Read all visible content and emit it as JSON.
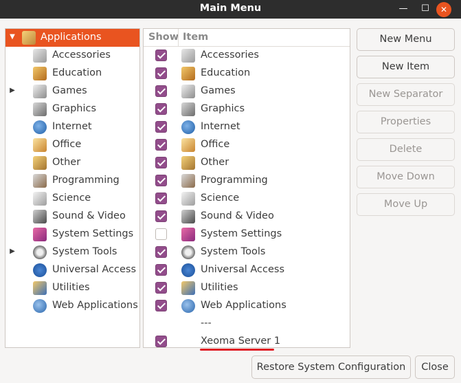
{
  "window": {
    "title": "Main Menu",
    "controls": {
      "minimize": "—",
      "maximize": "☐",
      "close": "✕"
    }
  },
  "tree": {
    "root": {
      "label": "Applications",
      "icon": "applications-icon",
      "expander": "▼"
    },
    "items": [
      {
        "label": "Accessories",
        "icon": "accessories-icon",
        "expander": ""
      },
      {
        "label": "Education",
        "icon": "education-icon",
        "expander": ""
      },
      {
        "label": "Games",
        "icon": "games-icon",
        "expander": "▶"
      },
      {
        "label": "Graphics",
        "icon": "graphics-icon",
        "expander": ""
      },
      {
        "label": "Internet",
        "icon": "internet-icon",
        "expander": ""
      },
      {
        "label": "Office",
        "icon": "office-icon",
        "expander": ""
      },
      {
        "label": "Other",
        "icon": "other-icon",
        "expander": ""
      },
      {
        "label": "Programming",
        "icon": "programming-icon",
        "expander": ""
      },
      {
        "label": "Science",
        "icon": "science-icon",
        "expander": ""
      },
      {
        "label": "Sound & Video",
        "icon": "sound-video-icon",
        "expander": ""
      },
      {
        "label": "System Settings",
        "icon": "system-settings-icon",
        "expander": ""
      },
      {
        "label": "System Tools",
        "icon": "system-tools-icon",
        "expander": "▶"
      },
      {
        "label": "Universal Access",
        "icon": "universal-access-icon",
        "expander": ""
      },
      {
        "label": "Utilities",
        "icon": "utilities-icon",
        "expander": ""
      },
      {
        "label": "Web Applications",
        "icon": "web-applications-icon",
        "expander": ""
      }
    ]
  },
  "list": {
    "headers": {
      "show": "Show",
      "item": "Item"
    },
    "rows": [
      {
        "label": "Accessories",
        "checked": true,
        "icon": "accessories-icon"
      },
      {
        "label": "Education",
        "checked": true,
        "icon": "education-icon"
      },
      {
        "label": "Games",
        "checked": true,
        "icon": "games-icon"
      },
      {
        "label": "Graphics",
        "checked": true,
        "icon": "graphics-icon"
      },
      {
        "label": "Internet",
        "checked": true,
        "icon": "internet-icon"
      },
      {
        "label": "Office",
        "checked": true,
        "icon": "office-icon"
      },
      {
        "label": "Other",
        "checked": true,
        "icon": "other-icon"
      },
      {
        "label": "Programming",
        "checked": true,
        "icon": "programming-icon"
      },
      {
        "label": "Science",
        "checked": true,
        "icon": "science-icon"
      },
      {
        "label": "Sound & Video",
        "checked": true,
        "icon": "sound-video-icon"
      },
      {
        "label": "System Settings",
        "checked": false,
        "icon": "system-settings-icon"
      },
      {
        "label": "System Tools",
        "checked": true,
        "icon": "system-tools-icon"
      },
      {
        "label": "Universal Access",
        "checked": true,
        "icon": "universal-access-icon"
      },
      {
        "label": "Utilities",
        "checked": true,
        "icon": "utilities-icon"
      },
      {
        "label": "Web Applications",
        "checked": true,
        "icon": "web-applications-icon"
      },
      {
        "label": "---",
        "checked": null,
        "icon": ""
      },
      {
        "label": "Xeoma Server 1",
        "checked": true,
        "icon": "",
        "highlight_color": "#e01b24"
      }
    ]
  },
  "buttons": {
    "new_menu": "New Menu",
    "new_item": "New Item",
    "new_separator": "New Separator",
    "properties": "Properties",
    "delete": "Delete",
    "move_down": "Move Down",
    "move_up": "Move Up",
    "restore": "Restore System Configuration",
    "close": "Close"
  },
  "colors": {
    "selection": "#e95420",
    "checkbox": "#924d8b",
    "titlebar": "#2d2d2d",
    "annotation_underline": "#e01b24"
  }
}
